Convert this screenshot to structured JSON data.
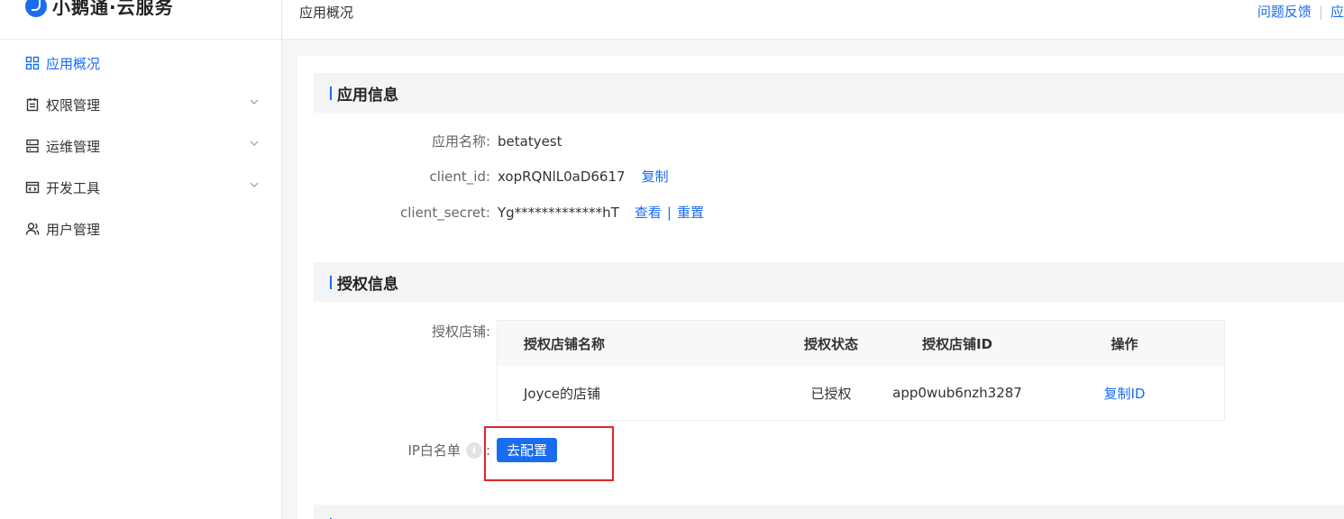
{
  "brand": {
    "name": "小鹅通·云服务"
  },
  "header": {
    "breadcrumb": "应用概况",
    "links": [
      "问题反馈",
      "应"
    ]
  },
  "sidebar": {
    "items": [
      {
        "label": "应用概况",
        "icon": "grid-icon",
        "active": true
      },
      {
        "label": "权限管理",
        "icon": "clipboard-icon",
        "expandable": true
      },
      {
        "label": "运维管理",
        "icon": "server-icon",
        "expandable": true
      },
      {
        "label": "开发工具",
        "icon": "code-window-icon",
        "expandable": true
      },
      {
        "label": "用户管理",
        "icon": "users-icon"
      }
    ]
  },
  "app_info": {
    "title": "应用信息",
    "name_label": "应用名称:",
    "name_value": "betatyest",
    "client_id_label": "client_id:",
    "client_id_value": "xopRQNlL0aD6617",
    "copy_label": "复制",
    "secret_label": "client_secret:",
    "secret_value": "Yg*************hT",
    "view_label": "查看",
    "sep": "|",
    "reset_label": "重置"
  },
  "auth_info": {
    "title": "授权信息",
    "shop_label": "授权店铺:",
    "columns": [
      "授权店铺名称",
      "授权状态",
      "授权店铺ID",
      "操作"
    ],
    "rows": [
      {
        "name": "Joyce的店铺",
        "status": "已授权",
        "id": "app0wub6nzh3287",
        "action": "复制ID"
      }
    ],
    "ip_label": "IP白名单",
    "ip_colon": ":",
    "info_glyph": "i",
    "config_button": "去配置"
  },
  "colors": {
    "accent": "#1a6cf0",
    "highlight": "#d9272e"
  }
}
